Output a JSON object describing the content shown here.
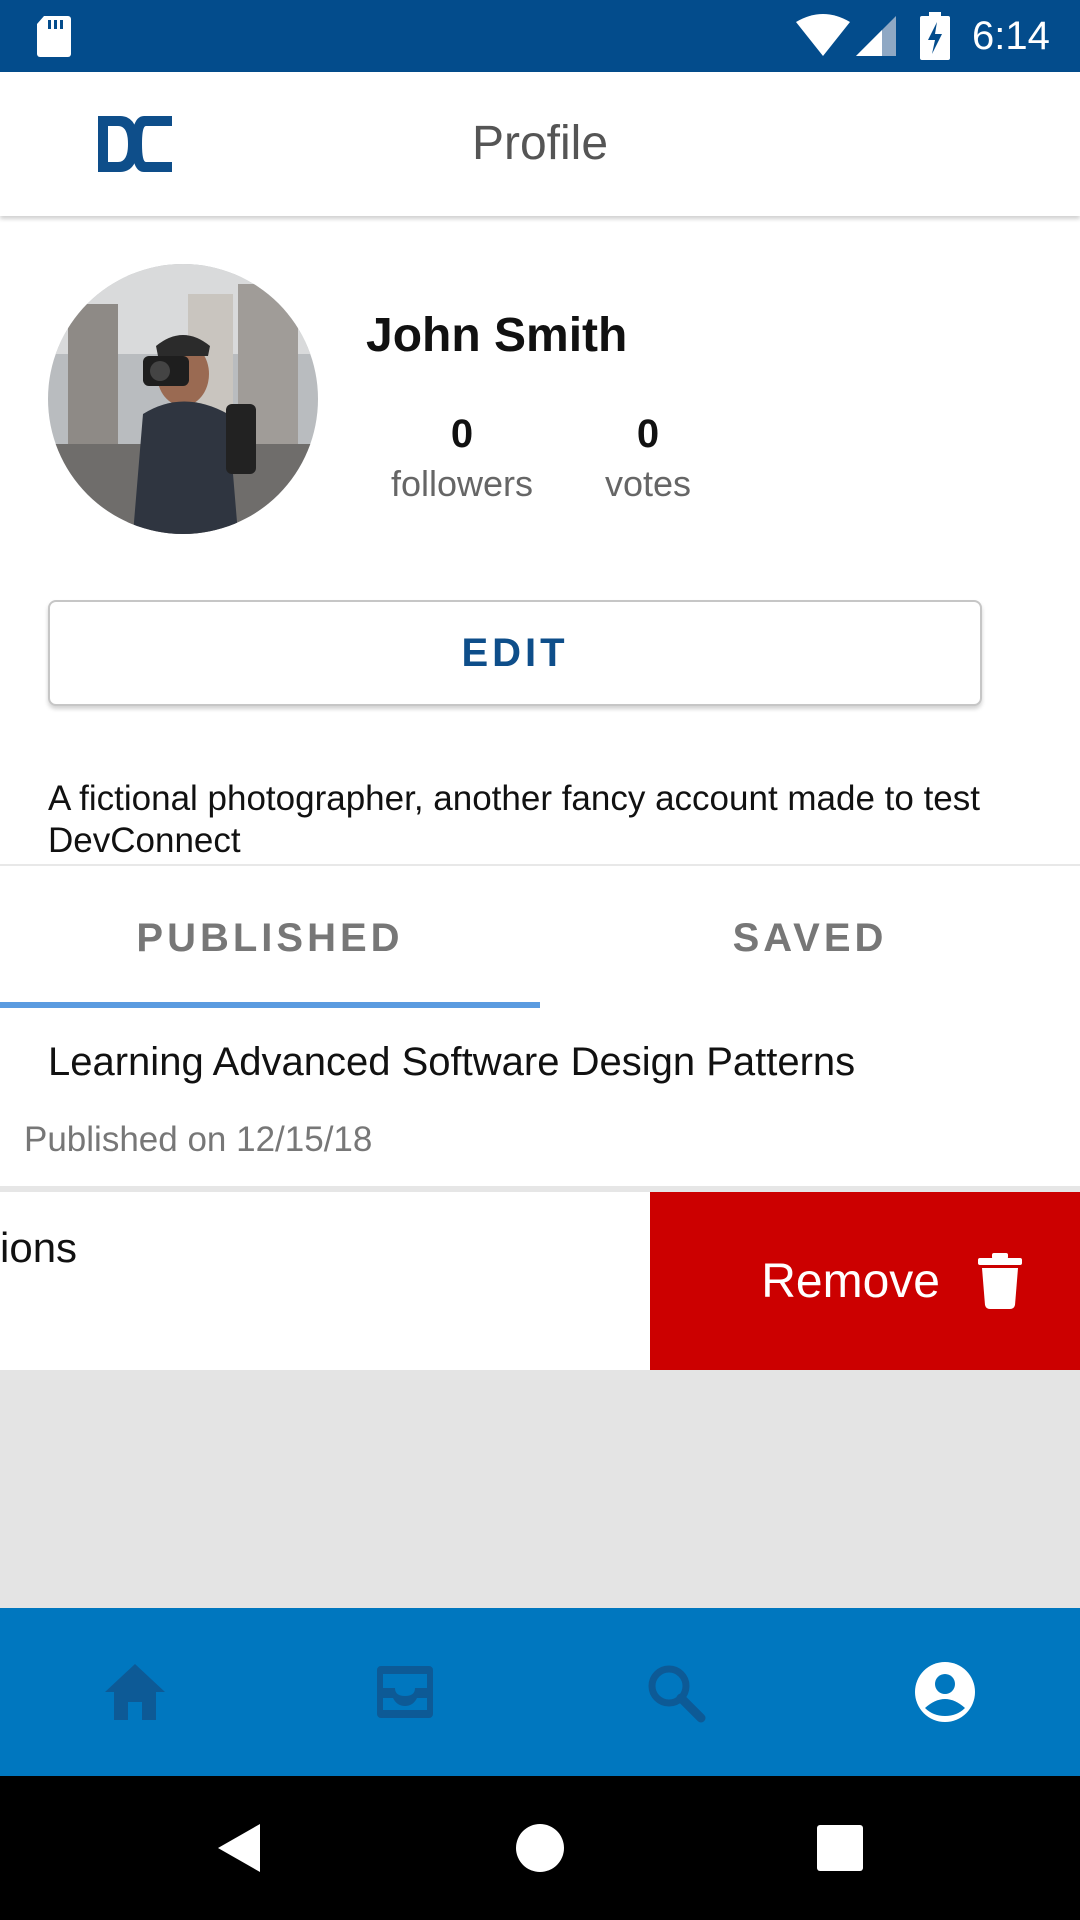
{
  "status_bar": {
    "time": "6:14",
    "icons": [
      "sd-card-icon",
      "wifi-icon",
      "signal-icon",
      "battery-charging-icon"
    ]
  },
  "header": {
    "title": "Profile",
    "logo_icon": "dc-logo-icon"
  },
  "profile": {
    "name": "John Smith",
    "followers": {
      "count": "0",
      "label": "followers"
    },
    "votes": {
      "count": "0",
      "label": "votes"
    },
    "edit_label": "EDIT",
    "bio": "A fictional photographer, another fancy account made to test DevConnect"
  },
  "tabs": [
    {
      "label": "PUBLISHED",
      "active": true
    },
    {
      "label": "SAVED",
      "active": false
    }
  ],
  "posts": [
    {
      "title": "Learning Advanced Software Design Patterns",
      "date": "Published on 12/15/18"
    },
    {
      "title_visible_fragment": "ions"
    }
  ],
  "swipe_action": {
    "label": "Remove",
    "icon": "trash-icon",
    "color": "#cc0000"
  },
  "bottom_nav": {
    "items": [
      {
        "icon": "home-icon",
        "active": false
      },
      {
        "icon": "inbox-icon",
        "active": false
      },
      {
        "icon": "search-icon",
        "active": false
      },
      {
        "icon": "account-circle-icon",
        "active": true
      }
    ]
  },
  "colors": {
    "status_bar": "#034c8c",
    "accent": "#0077bf",
    "nav_inactive": "#0d5a96",
    "tab_indicator": "#5a9be0"
  }
}
